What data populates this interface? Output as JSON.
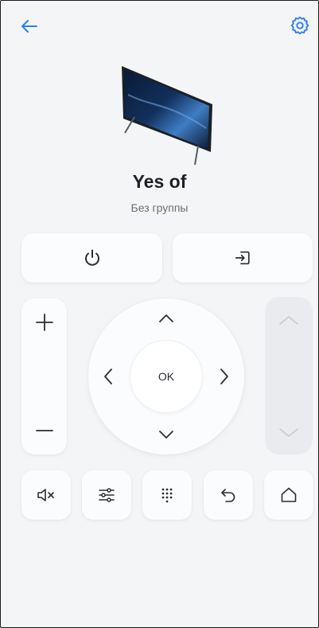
{
  "device": {
    "name": "Yes of",
    "group": "Без группы"
  },
  "remote": {
    "ok_label": "OK"
  },
  "colors": {
    "accent": "#2f7ff0",
    "background": "#f4f5f7",
    "card": "#fbfcfd",
    "icon": "#2b2e34",
    "disabled": "#c7cbd1"
  },
  "icons": {
    "back": "arrow-left-icon",
    "settings": "gear-icon",
    "power": "power-icon",
    "input": "input-source-icon",
    "volume_up": "plus-icon",
    "volume_down": "minus-icon",
    "channel_up": "chevron-up-icon",
    "channel_down": "chevron-down-icon",
    "mute": "mute-icon",
    "menu": "sliders-icon",
    "numpad": "keypad-icon",
    "return": "return-icon",
    "home": "home-icon"
  }
}
